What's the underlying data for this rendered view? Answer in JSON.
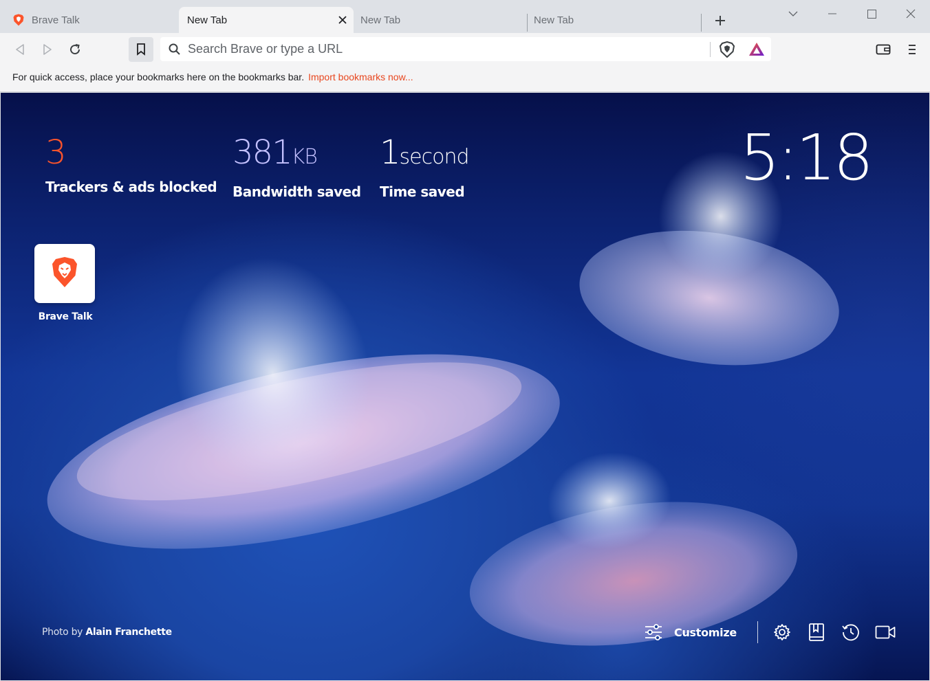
{
  "tabs": [
    {
      "title": "Brave Talk",
      "active": false,
      "favicon": "brave-lion-icon"
    },
    {
      "title": "New Tab",
      "active": true
    },
    {
      "title": "New Tab",
      "active": false
    },
    {
      "title": "New Tab",
      "active": false
    }
  ],
  "toolbar": {
    "search_placeholder": "Search Brave or type a URL"
  },
  "bookmarks_bar": {
    "message": "For quick access, place your bookmarks here on the bookmarks bar.",
    "import_link": "Import bookmarks now..."
  },
  "ntp": {
    "stats": {
      "trackers": {
        "value": "3",
        "label": "Trackers & ads blocked",
        "color": "#fb542b"
      },
      "bandwidth": {
        "value": "381",
        "unit": "KB",
        "label": "Bandwidth saved",
        "color": "#c4c1ff"
      },
      "time": {
        "value": "1",
        "unit": "second",
        "label": "Time saved",
        "color": "#ffffff"
      }
    },
    "clock": "5:18",
    "top_sites": [
      {
        "label": "Brave Talk",
        "icon": "brave-lion-icon"
      }
    ],
    "photo_credit": {
      "prefix": "Photo by ",
      "author": "Alain Franchette"
    },
    "customize_label": "Customize"
  },
  "colors": {
    "brand": "#fb542b",
    "link": "#e8461e"
  }
}
